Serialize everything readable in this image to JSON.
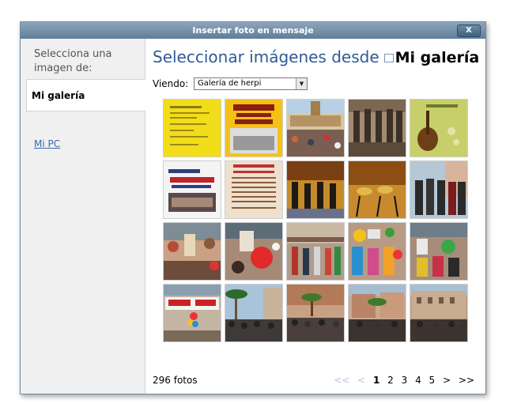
{
  "dialog": {
    "title": "Insertar foto en mensaje",
    "close_label": "X"
  },
  "sidebar": {
    "heading": "Selecciona una imagen de:",
    "items": [
      {
        "label": "Mi galería"
      },
      {
        "label": "Mi PC"
      }
    ]
  },
  "main": {
    "heading_prefix": "Seleccionar imágenes desde",
    "heading_gallery": "Mi galería",
    "viewing_label": "Viendo:",
    "viewing_value": "Galería de herpi",
    "thumbnails": [
      "Poster yellow",
      "Fiestas del Emigrante 2011",
      "Town plaza crowd",
      "Vintage band photo",
      "Festa Major mandolin",
      "Concert Solidari",
      "Programa fiestas",
      "Choir on stage",
      "Instruments on stage",
      "Band group in street",
      "Parade balloons",
      "Red balloon crowd",
      "Plaza crowd",
      "Colorful costumes",
      "Carnival costumes",
      "Visca banner",
      "Palm square crowd",
      "Group under palms",
      "Palms plaza",
      "Building crowd"
    ],
    "count_label": "296 fotos"
  },
  "pager": {
    "first": "<<",
    "prev": "<",
    "pages": [
      "1",
      "2",
      "3",
      "4",
      "5"
    ],
    "next": ">",
    "last": ">>"
  }
}
